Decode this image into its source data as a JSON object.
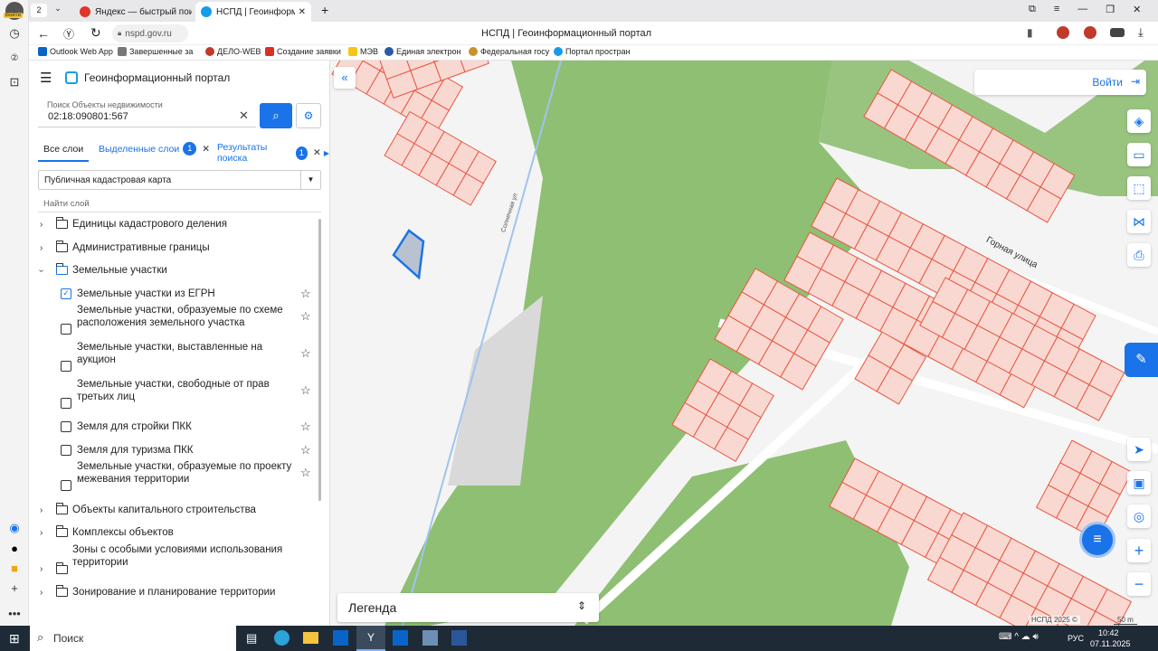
{
  "browser": {
    "tab_count": "2",
    "tabs": [
      {
        "label": "Яндекс — быстрый поиск"
      },
      {
        "label": "НСПД | Геоинформацио"
      }
    ],
    "url": "nspd.gov.ru",
    "page_title": "НСПД | Геоинформационный портал",
    "login_badge": "Войти",
    "bookmarks": [
      "Outlook Web App",
      "Завершенные за",
      "ДЕЛО-WEB",
      "Создание заявки",
      "МЭВ",
      "Единая электрон",
      "Федеральная госу",
      "Портал простран"
    ]
  },
  "panel": {
    "title": "Геоинформационный портал",
    "search_label": "Поиск Объекты недвижимости",
    "search_value": "02:18:090801:567",
    "tabs": [
      {
        "label": "Все слои"
      },
      {
        "label": "Выделенные слои",
        "badge": "1"
      },
      {
        "label": "Результаты поиска",
        "badge": "1"
      }
    ],
    "map_select": "Публичная кадастровая карта",
    "find_layer": "Найти слой",
    "tree": [
      {
        "label": "Единицы кадастрового деления"
      },
      {
        "label": "Административные границы"
      },
      {
        "label": "Земельные участки"
      }
    ],
    "sublayers": [
      {
        "line1": "Земельные участки из ЕГРН",
        "line2": ""
      },
      {
        "line1": "Земельные участки, образуемые по схеме",
        "line2": "расположения земельного участка"
      },
      {
        "line1": "Земельные участки, выставленные на",
        "line2": "аукцион"
      },
      {
        "line1": "Земельные участки, свободные от прав",
        "line2": "третьих лиц"
      },
      {
        "line1": "Земля для стройки ПКК",
        "line2": ""
      },
      {
        "line1": "Земля для туризма ПКК",
        "line2": ""
      },
      {
        "line1": "Земельные участки, образуемые по проекту",
        "line2": "межевания территории"
      }
    ],
    "tree2": [
      {
        "line1": "Объекты капитального строительства",
        "line2": ""
      },
      {
        "line1": "Комплексы объектов",
        "line2": ""
      },
      {
        "line1": "Зоны с особыми условиями использования",
        "line2": "территории"
      },
      {
        "line1": "Зонирование и планирование территории",
        "line2": ""
      }
    ]
  },
  "map": {
    "login": "Войти",
    "legend": "Легенда",
    "street_gornaya": "Горная улица",
    "street_small": "Солнечная ул",
    "copyright": "НСПД 2025 ©",
    "scale": "50 m",
    "colors": {
      "parcel_fill": "#f9d8d2",
      "parcel_line": "#e8563f",
      "forest": "#8fbf73",
      "accent": "#1a73e8"
    }
  },
  "taskbar": {
    "search": "Поиск",
    "lang": "РУС",
    "time": "10:42",
    "date": "07.11.2025"
  }
}
